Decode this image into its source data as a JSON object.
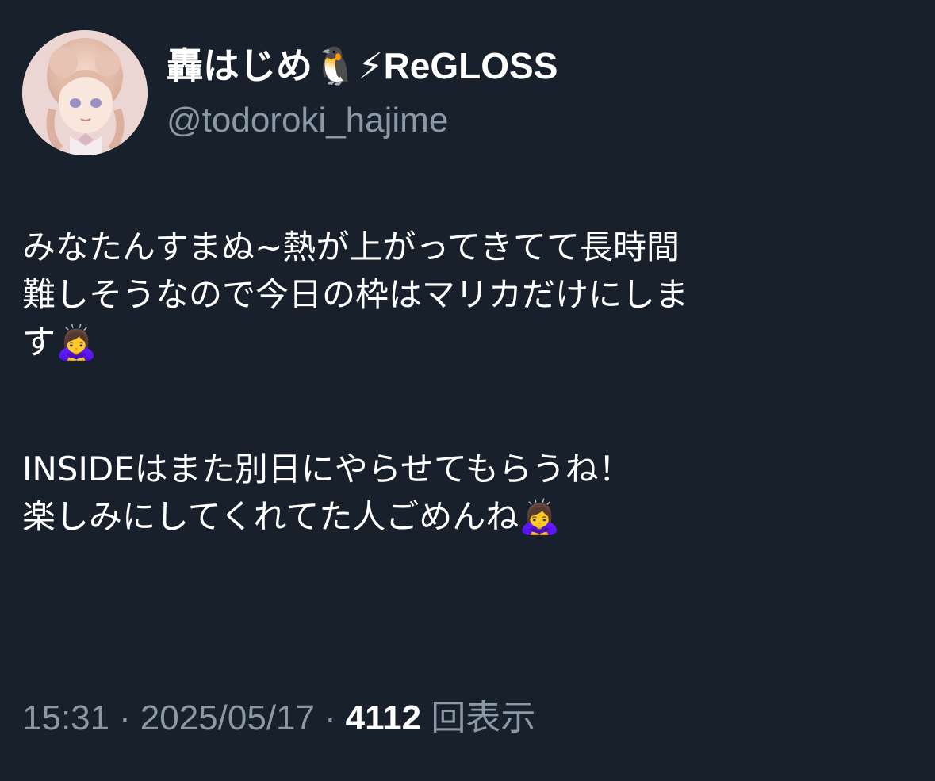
{
  "tweet": {
    "author": {
      "display_name": "轟はじめ🐧⚡ReGLOSS",
      "handle": "@todoroki_hajime",
      "avatar_icon": "avatar-image"
    },
    "text_lines_paragraph1": [
      "みなたんすまぬ~熱が上がってきてて長時間",
      "難しそうなので今日の枠はマリカだけにしま",
      "す🙇‍♀️"
    ],
    "text_lines_paragraph2": [
      "INSIDEはまた別日にやらせてもらうね！",
      "楽しみにしてくれてた人ごめんね🙇‍♀️"
    ],
    "time": "15:31",
    "date": "2025/05/17",
    "views_count": "4112",
    "views_label": "回表示",
    "separator": "·"
  },
  "colors": {
    "background": "#17202b",
    "text_primary": "#ffffff",
    "text_secondary": "#8b98a5"
  }
}
